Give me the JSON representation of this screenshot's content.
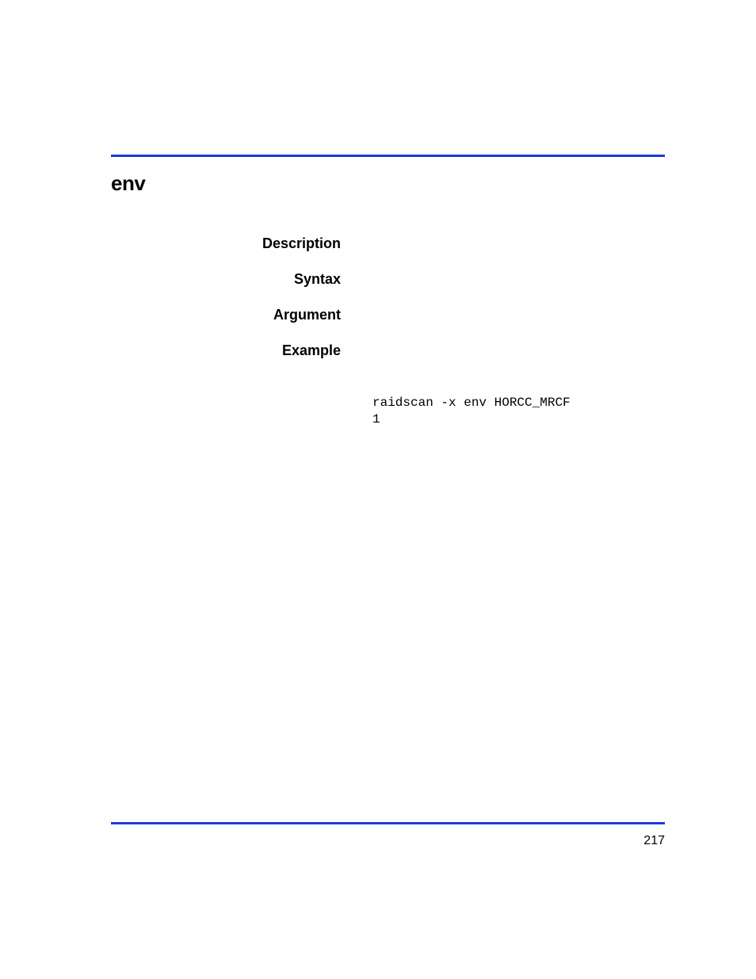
{
  "page": {
    "title": "env",
    "sections": {
      "description": "Description",
      "syntax": "Syntax",
      "argument": "Argument",
      "example": "Example"
    },
    "code_example": "raidscan -x env HORCC_MRCF\n1",
    "page_number": "217"
  }
}
